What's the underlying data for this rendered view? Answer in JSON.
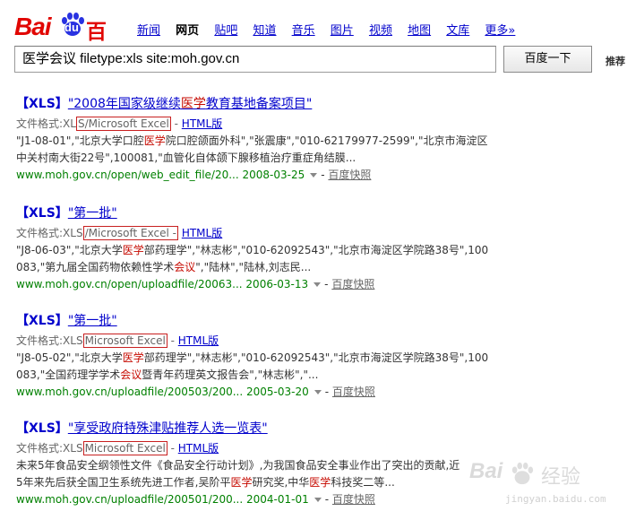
{
  "logo": {
    "text_bai": "Bai",
    "text_du": "du",
    "text_cn": "百度"
  },
  "nav": [
    "新闻",
    "网页",
    "贴吧",
    "知道",
    "音乐",
    "图片",
    "视频",
    "地图",
    "文库",
    "更多»"
  ],
  "nav_active": "网页",
  "search": {
    "query": "医学会议  filetype:xls site:moh.gov.cn",
    "button": "百度一下",
    "recommend": "推荐"
  },
  "results": [
    {
      "tag": "【XLS】",
      "title_parts": [
        "\"2008年国家级继续",
        "医学",
        "教育基地备案项目\""
      ],
      "meta": {
        "label": "文件格式:XL",
        "format": "S/Microsoft Excel",
        "sep": " - ",
        "html": "HTML版"
      },
      "lines": [
        [
          "\"J1-08-01\",\"北京大学口腔",
          "医学",
          "院口腔颌面外科\",\"张震康\",\"010-62179977-2599\",\"北京市海淀区"
        ],
        [
          "中关村南大街22号\",100081,\"血管化自体颌下腺移植治疗重症角结膜..."
        ]
      ],
      "url": "www.moh.gov.cn/open/web_edit_file/20...",
      "date": "2008-03-25",
      "snapshot": "百度快照"
    },
    {
      "tag": "【XLS】",
      "title_parts": [
        "\"第一批\""
      ],
      "meta": {
        "label": "文件格式:XLS",
        "format": "/Microsoft Excel -",
        "sep": " ",
        "html": "HTML版"
      },
      "lines": [
        [
          "\"J8-06-03\",\"北京大学",
          "医学",
          "部药理学\",\"林志彬\",\"010-62092543\",\"北京市海淀区学院路38号\",100"
        ],
        [
          "083,\"第九届全国药物依赖性学术",
          "会议",
          "\",\"陆林\",\"陆林,刘志民..."
        ]
      ],
      "url": "www.moh.gov.cn/open/uploadfile/20063...",
      "date": "2006-03-13",
      "snapshot": "百度快照"
    },
    {
      "tag": "【XLS】",
      "title_parts": [
        "\"第一批\""
      ],
      "meta": {
        "label": "文件格式:XLS",
        "format": "Microsoft Excel",
        "sep": " - ",
        "html": "HTML版"
      },
      "lines": [
        [
          "\"J8-05-02\",\"北京大学",
          "医学",
          "部药理学\",\"林志彬\",\"010-62092543\",\"北京市海淀区学院路38号\",100"
        ],
        [
          "083,\"全国药理学学术",
          "会议",
          "暨青年药理英文报告会\",\"林志彬\",\"..."
        ]
      ],
      "url": "www.moh.gov.cn/uploadfile/200503/200...",
      "date": "2005-03-20",
      "snapshot": "百度快照"
    },
    {
      "tag": "【XLS】",
      "title_parts": [
        "\"享受政府特殊津贴推荐人选一览表\""
      ],
      "meta": {
        "label": "文件格式:XLS",
        "format": "Microsoft Excel",
        "sep": " - ",
        "html": "HTML版"
      },
      "lines": [
        [
          "未来5年食品安全纲领性文件《食品安全行动计划》,为我国食品安全事业作出了突出的贡献,近"
        ],
        [
          "5年来先后获全国卫生系统先进工作者,吴阶平",
          "医学",
          "研究奖,中华",
          "医学",
          "科技奖二等..."
        ]
      ],
      "url": "www.moh.gov.cn/uploadfile/200501/200...",
      "date": "2004-01-01",
      "snapshot": "百度快照"
    }
  ],
  "watermark": {
    "brand": "Bai",
    "cn": "经验",
    "url": "jingyan.baidu.com"
  },
  "colors": {
    "brand_red": "#e10602",
    "link": "#0000cc",
    "url_green": "#008000",
    "highlight": "#c60a00"
  }
}
